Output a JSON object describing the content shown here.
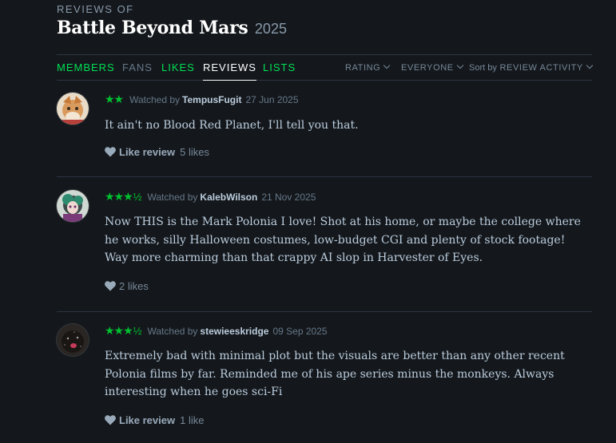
{
  "header": {
    "kicker": "REVIEWS OF",
    "film_title": "Battle Beyond Mars",
    "film_year": "2025"
  },
  "tabs": [
    {
      "label": "MEMBERS",
      "active": false
    },
    {
      "label": "FANS",
      "active": false
    },
    {
      "label": "LIKES",
      "active": false
    },
    {
      "label": "REVIEWS",
      "active": true
    },
    {
      "label": "LISTS",
      "active": false
    }
  ],
  "filters": {
    "rating": "RATING",
    "everyone": "EVERYONE",
    "sort_prefix": "Sort by",
    "sort_value": "REVIEW ACTIVITY"
  },
  "reviews": [
    {
      "stars": "★★",
      "half": "",
      "watched_label": "Watched by",
      "username": "TempusFugit",
      "date": "27 Jun 2025",
      "text": "It ain't no Blood Red Planet, I'll tell you that.",
      "like_label": "Like review",
      "likes": "5 likes"
    },
    {
      "stars": "★★★",
      "half": "½",
      "watched_label": "Watched by",
      "username": "KalebWilson",
      "date": "21 Nov 2025",
      "text": "Now THIS is the Mark Polonia I love! Shot at his home, or maybe the college where he works, silly Halloween costumes, low-budget CGI and plenty of stock footage! Way more charming than that crappy AI slop in Harvester of Eyes.",
      "like_label": "",
      "likes": "2 likes"
    },
    {
      "stars": "★★★",
      "half": "½",
      "watched_label": "Watched by",
      "username": "stewieeskridge",
      "date": "09 Sep 2025",
      "text": "Extremely bad with minimal plot but the visuals are better than any other recent Polonia films by far. Reminded me of his ape series minus the monkeys. Always interesting when he goes sci-Fi",
      "like_label": "Like review",
      "likes": "1 like"
    }
  ],
  "colors": {
    "background": "#14181c",
    "accent_green": "#00e054",
    "star_green": "#00c030",
    "divider": "#2c3440"
  }
}
